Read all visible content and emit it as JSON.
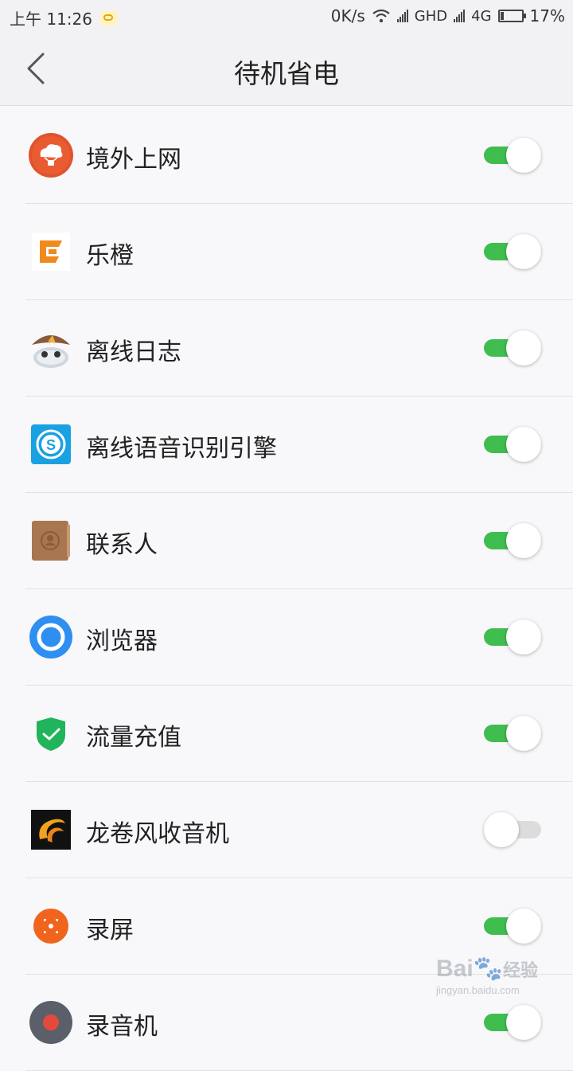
{
  "status_bar": {
    "time": "上午 11:26",
    "net_speed": "0K/s",
    "network_1": "GHD",
    "network_2": "4G",
    "battery_level": 0.17,
    "battery_text": "17%"
  },
  "header": {
    "back_icon": "chevron-left-icon",
    "title": "待机省电"
  },
  "apps": [
    {
      "name": "境外上网",
      "icon": "cloud-balloon-icon",
      "enabled": true
    },
    {
      "name": "乐橙",
      "icon": "lechange-logo-icon",
      "enabled": true
    },
    {
      "name": "离线日志",
      "icon": "mushroom-robot-icon",
      "enabled": true
    },
    {
      "name": "离线语音识别引擎",
      "icon": "speech-s-icon",
      "enabled": true
    },
    {
      "name": "联系人",
      "icon": "contacts-book-icon",
      "enabled": true
    },
    {
      "name": "浏览器",
      "icon": "browser-ring-icon",
      "enabled": true
    },
    {
      "name": "流量充值",
      "icon": "shield-check-icon",
      "enabled": true
    },
    {
      "name": "龙卷风收音机",
      "icon": "tornado-radio-icon",
      "enabled": false
    },
    {
      "name": "录屏",
      "icon": "screen-record-icon",
      "enabled": true
    },
    {
      "name": "录音机",
      "icon": "recorder-icon",
      "enabled": true
    }
  ],
  "watermark": {
    "brand": "Bai",
    "brand_cn": "经验",
    "url": "jingyan.baidu.com"
  },
  "colors": {
    "toggle_on": "#3fbd4f",
    "toggle_off": "#dcdcdc"
  }
}
